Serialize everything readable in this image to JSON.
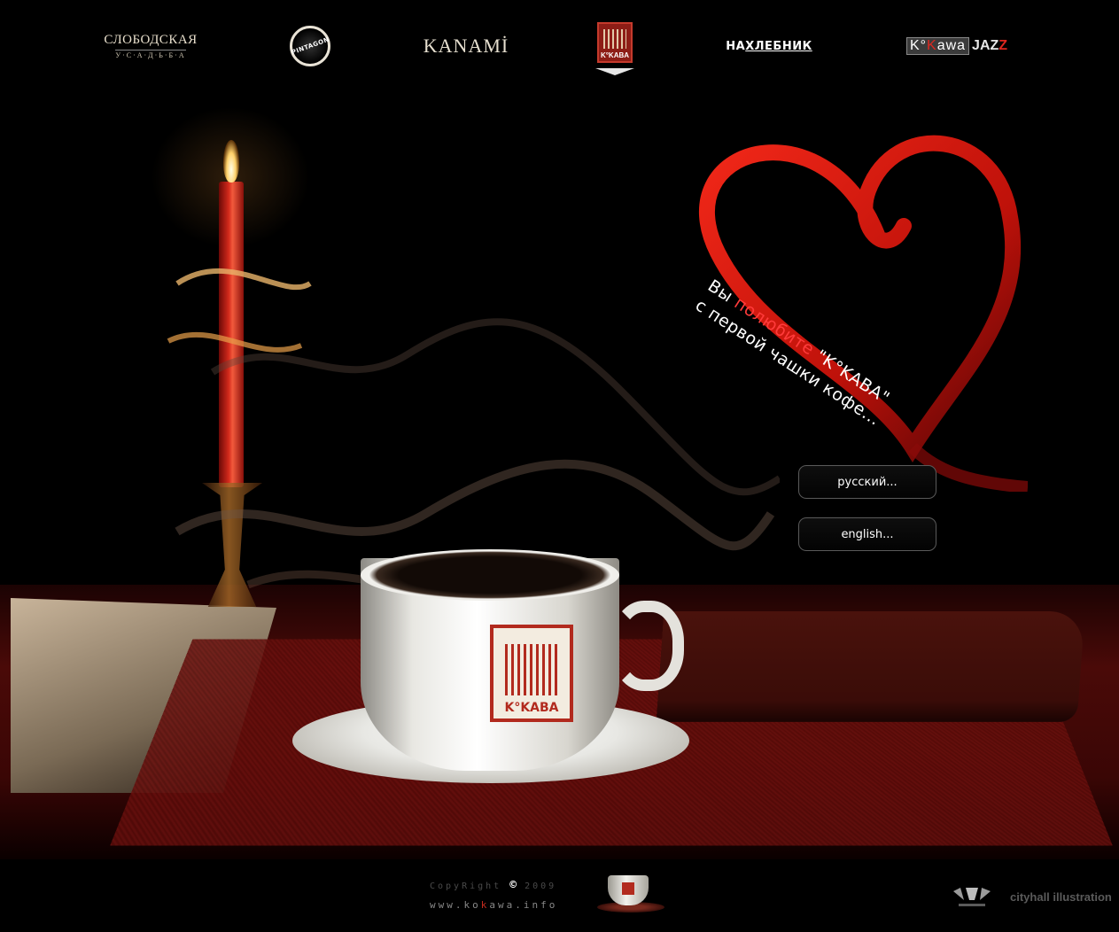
{
  "nav": {
    "items": [
      {
        "id": "slobodskaya",
        "line1": "СЛОБОДСКАЯ",
        "line2": "У·С·А·Д·Ь·Б·А"
      },
      {
        "id": "pintagon",
        "label": "PINTAGON"
      },
      {
        "id": "kanami",
        "label": "KANAMİ"
      },
      {
        "id": "kokava",
        "label": "K°KAВA",
        "active": true
      },
      {
        "id": "nahlebnik",
        "prefix": "НА",
        "label": "ХЛЕБНИК"
      },
      {
        "id": "kokawajazz",
        "k": "K°",
        "ka": "K",
        "awa": "awa",
        "jaz": "JAZ",
        "z": "Z"
      }
    ]
  },
  "slogan": {
    "line1_a": "Вы ",
    "line1_highlight": "полюбите",
    "line1_b": " \"K°KAВA\"",
    "line2": "с первой чашки кофе..."
  },
  "cup": {
    "logo_text": "K°KAВA"
  },
  "language": {
    "russian": "русский...",
    "english": "english..."
  },
  "footer": {
    "copyright_prefix": "CopyRight ",
    "copyright_symbol": "©",
    "copyright_year": " 2009",
    "site_a": "www.ko",
    "site_k": "k",
    "site_b": "awa.info",
    "credit": "cityhall illustration"
  },
  "colors": {
    "accent_red": "#ff3b3b",
    "brand_red": "#b22a1e",
    "background": "#000000"
  }
}
